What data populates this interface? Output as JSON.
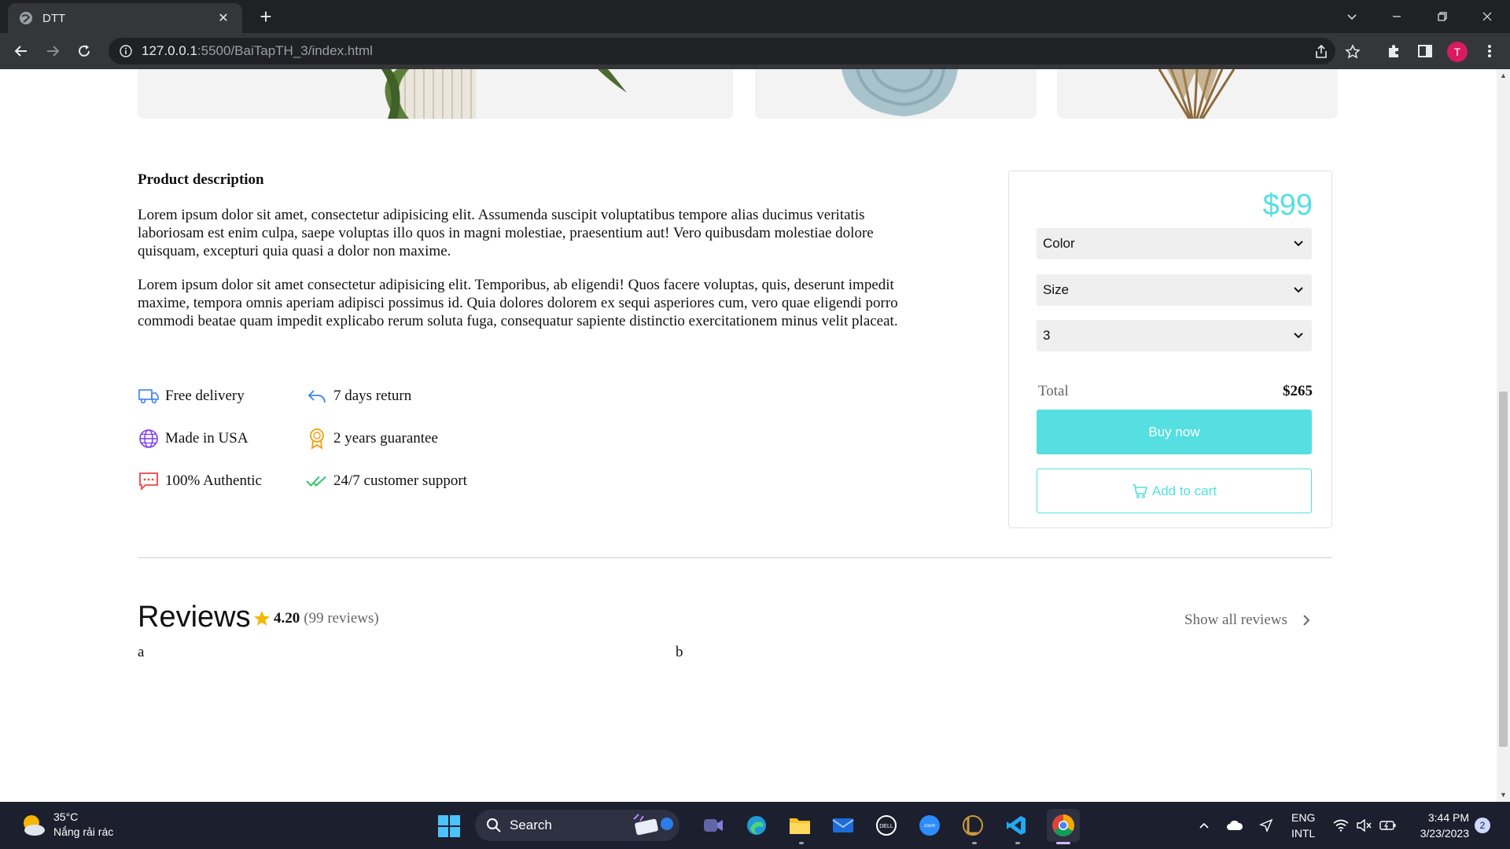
{
  "browser": {
    "tab_title": "DTT",
    "url_host": "127.0.0.1",
    "url_path": ":5500/BaiTapTH_3/index.html",
    "profile_initial": "T"
  },
  "product": {
    "description_title": "Product description",
    "paragraphs": [
      "Lorem ipsum dolor sit amet, consectetur adipisicing elit. Assumenda suscipit voluptatibus tempore alias ducimus veritatis laboriosam est enim culpa, saepe voluptas illo quos in magni molestiae, praesentium aut! Vero quibusdam molestiae dolore quisquam, excepturi quia quasi a dolor non maxime.",
      "Lorem ipsum dolor sit amet consectetur adipisicing elit. Temporibus, ab eligendi! Quos facere voluptas, quis, deserunt impedit maxime, tempora omnis aperiam adipisci possimus id. Quia dolores dolorem ex sequi asperiores cum, vero quae eligendi porro commodi beatae quam impedit explicabo rerum soluta fuga, consequatur sapiente distinctio exercitationem minus velit placeat."
    ],
    "features": [
      {
        "label": "Free delivery",
        "icon": "truck-icon"
      },
      {
        "label": "7 days return",
        "icon": "return-arrow-icon"
      },
      {
        "label": "Made in USA",
        "icon": "globe-icon"
      },
      {
        "label": "2 years guarantee",
        "icon": "award-icon"
      },
      {
        "label": "100% Authentic",
        "icon": "chat-bubble-icon"
      },
      {
        "label": "24/7 customer support",
        "icon": "double-check-icon"
      }
    ]
  },
  "purchase": {
    "price": "$99",
    "color_select": "Color",
    "size_select": "Size",
    "quantity_select": "3",
    "total_label": "Total",
    "total_value": "$265",
    "buy_label": "Buy now",
    "cart_label": "Add to cart",
    "accent_color": "#55dfe1"
  },
  "reviews": {
    "title": "Reviews",
    "score": "4.20",
    "count": "(99 reviews)",
    "show_all": "Show all reviews",
    "col_a": "a",
    "col_b": "b",
    "star_color": "#f5b800"
  },
  "taskbar": {
    "temperature": "35°C",
    "weather_desc": "Nắng rải rác",
    "search_label": "Search",
    "lang_top": "ENG",
    "lang_bottom": "INTL",
    "time": "3:44 PM",
    "date": "3/23/2023",
    "notification_count": "2"
  }
}
